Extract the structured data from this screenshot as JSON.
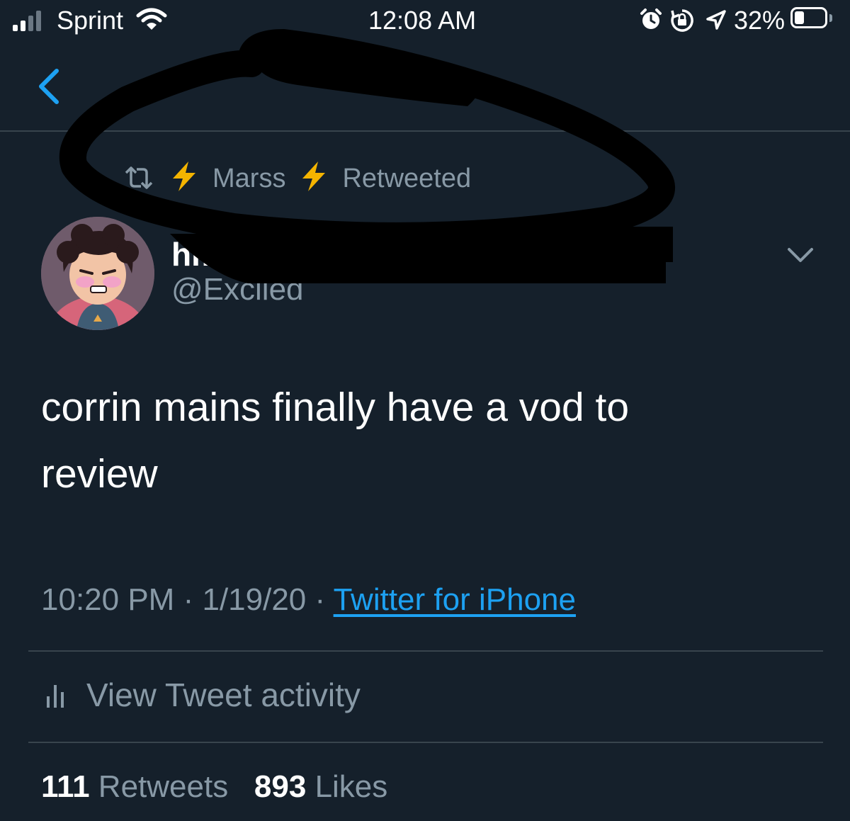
{
  "status_bar": {
    "carrier": "Sprint",
    "time": "12:08 AM",
    "battery_percent": "32%",
    "battery_level": 0.32,
    "icons": [
      "signal-icon",
      "wifi-icon",
      "alarm-icon",
      "rotation-lock-icon",
      "location-icon",
      "battery-icon"
    ]
  },
  "header": {
    "back_icon": "chevron-left-icon"
  },
  "retweet_context": {
    "icon": "retweet-icon",
    "lightning_left": "⚡",
    "user_name": "Marss",
    "lightning_right": "⚡",
    "action": "Retweeted"
  },
  "tweet": {
    "display_name_partial": "hm",
    "handle": "@Exciled",
    "text_line1": "corrin mains finally have a vod to",
    "text_line2": "review",
    "time": "10:20 PM",
    "separator": "·",
    "date": "1/19/20",
    "source": "Twitter for iPhone",
    "menu_icon": "chevron-down-icon"
  },
  "activity": {
    "icon": "bar-chart-icon",
    "label": "View Tweet activity"
  },
  "stats": {
    "retweets_count": "111",
    "retweets_label": "Retweets",
    "likes_count": "893",
    "likes_label": "Likes"
  },
  "colors": {
    "background": "#15202b",
    "secondary_text": "#8899a6",
    "accent": "#1da1f2",
    "divider": "#38444d",
    "lightning": "#f4b400"
  }
}
